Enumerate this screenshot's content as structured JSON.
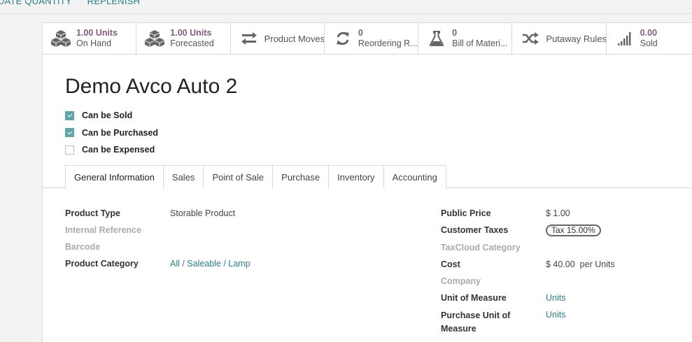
{
  "top_actions": [
    "DATE QUANTITY",
    "REPLENISH"
  ],
  "smart_buttons": [
    {
      "icon": "cubes-icon",
      "value": "1.00 Units",
      "label": "On Hand"
    },
    {
      "icon": "cubes-icon",
      "value": "1.00 Units",
      "label": "Forecasted"
    },
    {
      "icon": "exchange-icon",
      "label": "Product Moves"
    },
    {
      "icon": "refresh-icon",
      "value": "0",
      "label": "Reordering R..."
    },
    {
      "icon": "flask-icon",
      "value": "0",
      "label": "Bill of Materi..."
    },
    {
      "icon": "random-icon",
      "label": "Putaway Rules"
    },
    {
      "icon": "signal-icon",
      "value": "0.00",
      "label": "Sold"
    }
  ],
  "product": {
    "name": "Demo Avco Auto 2",
    "checkboxes": [
      {
        "label": "Can be Sold",
        "checked": true
      },
      {
        "label": "Can be Purchased",
        "checked": true
      },
      {
        "label": "Can be Expensed",
        "checked": false
      }
    ]
  },
  "tabs": [
    "General Information",
    "Sales",
    "Point of Sale",
    "Purchase",
    "Inventory",
    "Accounting"
  ],
  "left_fields": [
    {
      "label": "Product Type",
      "value": "Storable Product",
      "muted": false,
      "link": false
    },
    {
      "label": "Internal Reference",
      "value": "",
      "muted": true,
      "link": false
    },
    {
      "label": "Barcode",
      "value": "",
      "muted": true,
      "link": false
    },
    {
      "label": "Product Category",
      "value": "All / Saleable / Lamp",
      "muted": false,
      "link": true
    }
  ],
  "right_fields": {
    "public_price": {
      "label": "Public Price",
      "value": "$ 1.00"
    },
    "customer_taxes": {
      "label": "Customer Taxes",
      "value": "Tax 15.00%"
    },
    "taxcloud": {
      "label": "TaxCloud Category",
      "value": ""
    },
    "cost": {
      "label": "Cost",
      "value": "$ 40.00",
      "unit": "per Units"
    },
    "company": {
      "label": "Company",
      "value": ""
    },
    "uom": {
      "label": "Unit of Measure",
      "value": "Units"
    },
    "purchase_uom": {
      "label": "Purchase Unit of Measure",
      "value": "Units"
    }
  },
  "colors": {
    "accent": "#875a7b",
    "link": "#2a7f86",
    "checkbox": "#5ea6a8"
  }
}
